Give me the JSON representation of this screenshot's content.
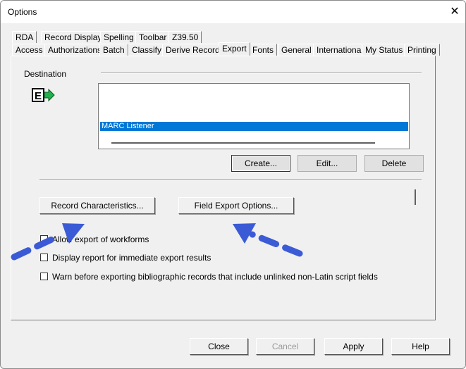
{
  "window": {
    "title": "Options",
    "close_glyph": "✕"
  },
  "tabs_row1": [
    "RDA",
    "Record Display",
    "Spelling",
    "Toolbar",
    "Z39.50"
  ],
  "tabs_row2": [
    "Access",
    "Authorizations",
    "Batch",
    "Classify",
    "Derive Record",
    "Export",
    "Fonts",
    "General",
    "International",
    "My Status",
    "Printing"
  ],
  "active_tab": "Export",
  "destination": {
    "label": "Destination",
    "icon_letter": "E",
    "selected_item": "MARC Listener"
  },
  "dest_buttons": {
    "create": "Create...",
    "edit": "Edit...",
    "delete": "Delete"
  },
  "options_buttons": {
    "record_characteristics": "Record Characteristics...",
    "field_export_options": "Field Export Options..."
  },
  "checkboxes": [
    {
      "label": "Allow export of workforms",
      "checked": false
    },
    {
      "label": "Display report for immediate export results",
      "checked": false
    },
    {
      "label": "Warn before exporting bibliographic records that include unlinked non-Latin script fields",
      "checked": false
    }
  ],
  "footer_buttons": {
    "close": "Close",
    "cancel": "Cancel",
    "apply": "Apply",
    "help": "Help"
  },
  "colors": {
    "arrow": "#3b5bd6",
    "selection": "#0078d7",
    "icon_green": "#22b14c"
  },
  "annotation_arrow_icons": [
    "arrow-annotation-left",
    "arrow-annotation-right"
  ]
}
